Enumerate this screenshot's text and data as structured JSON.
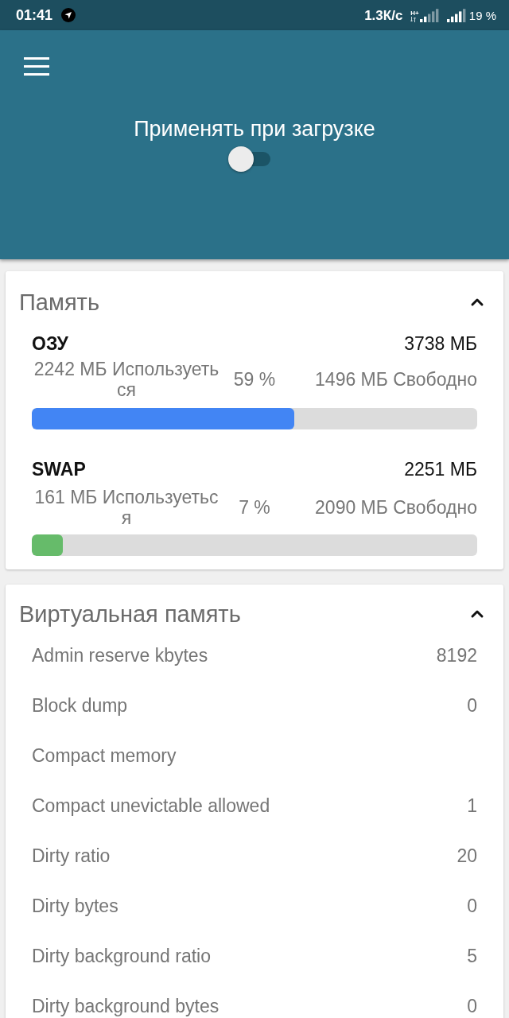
{
  "status_bar": {
    "time": "01:41",
    "speed": "1.3К/с",
    "network_type": "H+",
    "battery": "19 %"
  },
  "header": {
    "title": "Применять при загрузке",
    "switch": {
      "on": false
    }
  },
  "memory_card": {
    "title": "Память",
    "expanded": true,
    "meters": [
      {
        "name": "ОЗУ",
        "total": "3738 МБ",
        "used": "2242 МБ Используеться",
        "percent": "59 %",
        "free": "1496 МБ Свободно",
        "level": 0.59,
        "color": "#4285f4"
      },
      {
        "name": "SWAP",
        "total": "2251 МБ",
        "used": "161 МБ Используеться",
        "percent": "7 %",
        "free": "2090 МБ Свободно",
        "level": 0.07,
        "color": "#66bb6a"
      }
    ]
  },
  "virtual_memory_card": {
    "title": "Виртуальная память",
    "expanded": true,
    "rows": [
      {
        "label": "Admin reserve kbytes",
        "value": "8192"
      },
      {
        "label": "Block dump",
        "value": "0"
      },
      {
        "label": "Compact memory"
      },
      {
        "label": "Compact unevictable allowed",
        "value": "1"
      },
      {
        "label": "Dirty ratio",
        "value": "20"
      },
      {
        "label": "Dirty bytes",
        "value": "0"
      },
      {
        "label": "Dirty background ratio",
        "value": "5"
      },
      {
        "label": "Dirty background bytes",
        "value": "0"
      }
    ]
  }
}
